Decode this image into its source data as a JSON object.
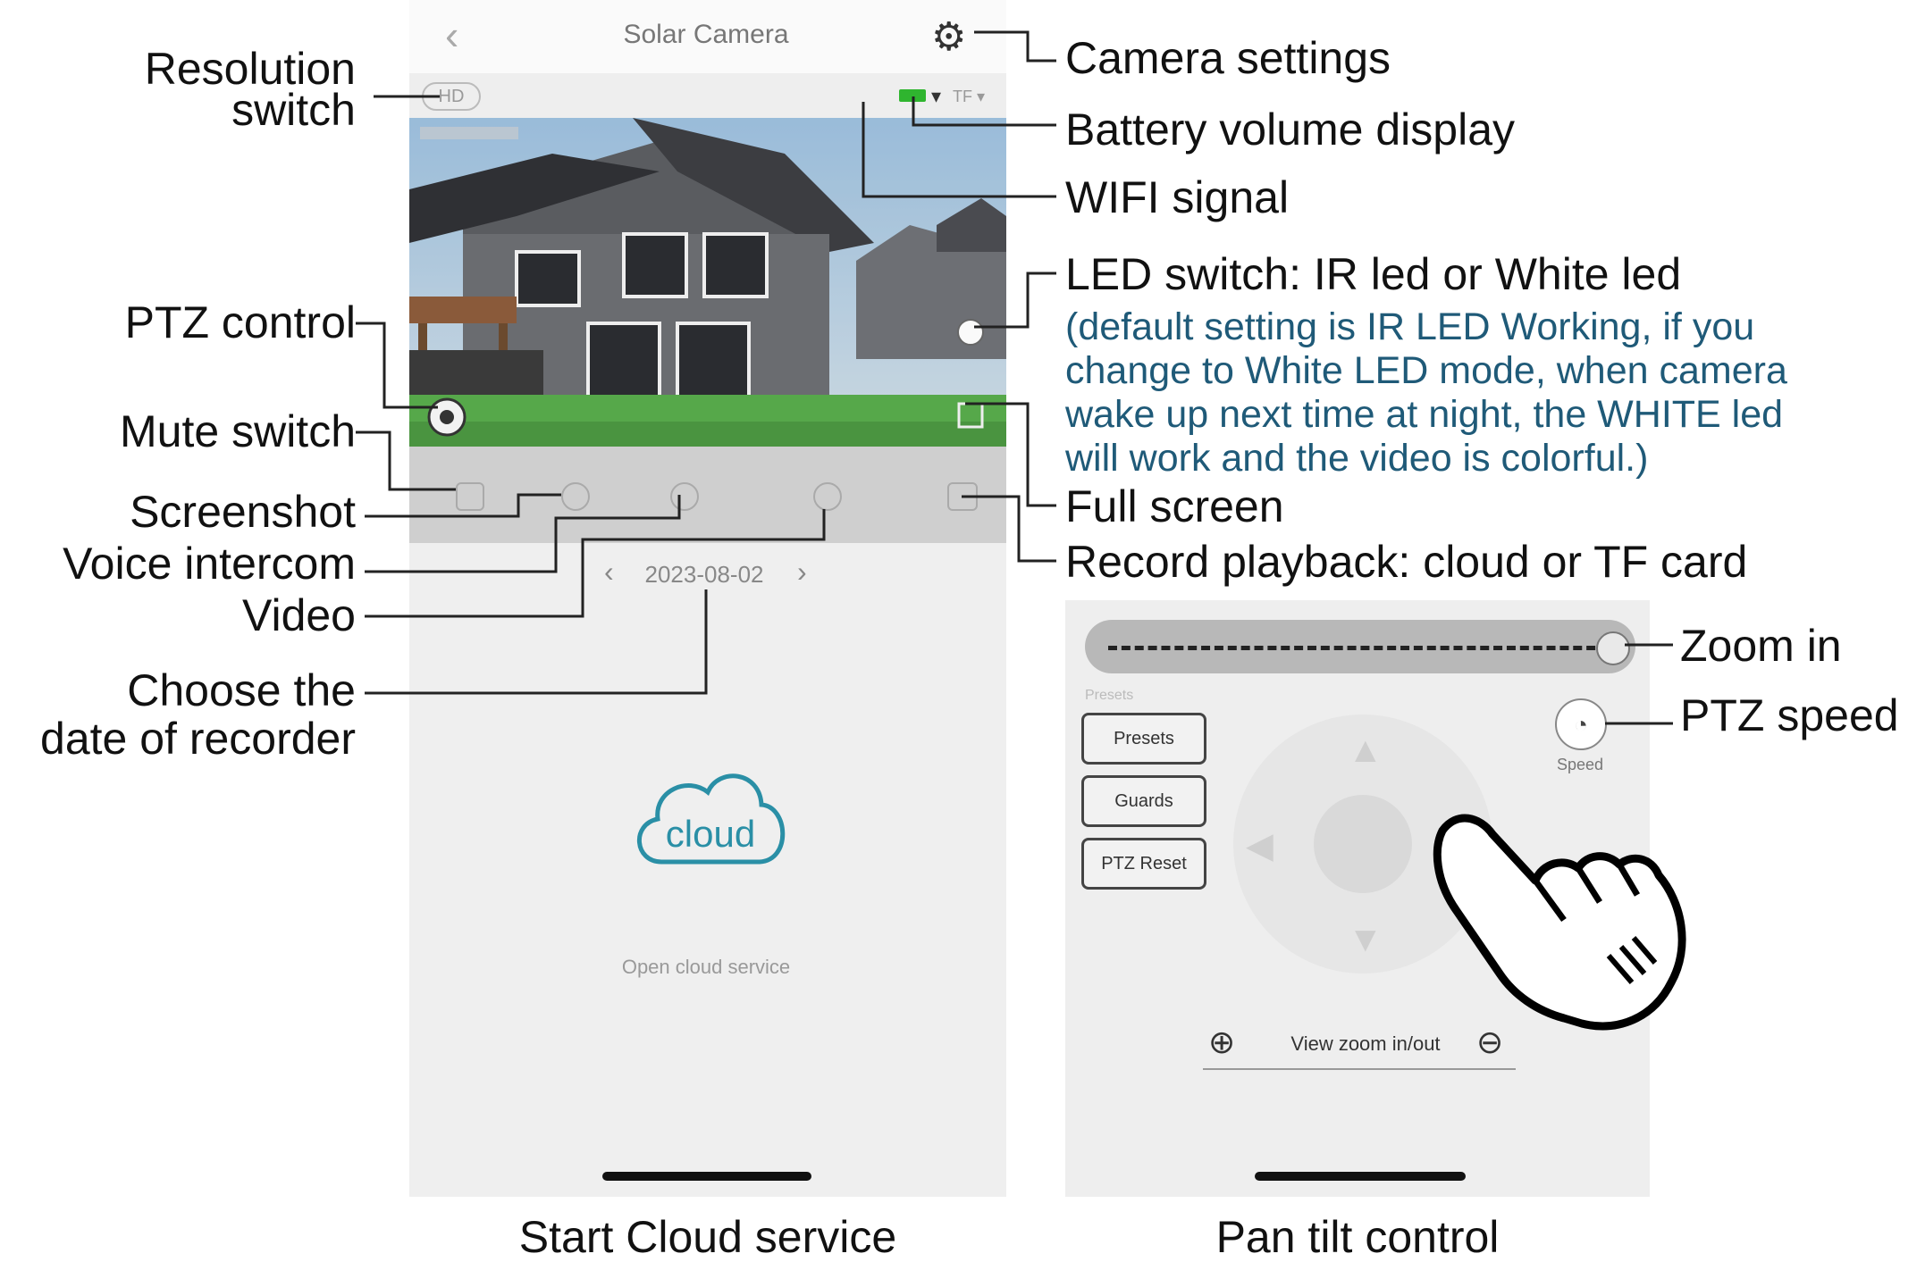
{
  "left_phone": {
    "title": "Solar Camera",
    "back_icon": "chevron-left-icon",
    "settings_icon": "gear-icon",
    "resolution_button": "HD",
    "signal_text": "TF ▾",
    "date": "2023-08-02",
    "date_prev_icon": "chevron-left-icon",
    "date_next_icon": "chevron-right-icon",
    "cloud_label": "cloud",
    "open_cloud_text": "Open cloud service"
  },
  "right_phone": {
    "presets_caption": "Presets",
    "buttons": [
      "Presets",
      "Guards",
      "PTZ Reset"
    ],
    "speed_label": "Speed",
    "zoom_label": "View zoom in/out",
    "zoom_in_icon": "zoom-in-icon",
    "zoom_out_icon": "zoom-out-icon"
  },
  "annotations_left": {
    "resolution_switch_1": "Resolution",
    "resolution_switch_2": "switch",
    "ptz_control": "PTZ control",
    "mute_switch": "Mute switch",
    "screenshot": "Screenshot",
    "voice_intercom": "Voice intercom",
    "video": "Video",
    "choose_date_1": "Choose the",
    "choose_date_2": "date of recorder"
  },
  "annotations_right": {
    "camera_settings": "Camera settings",
    "battery_volume": "Battery volume display",
    "wifi_signal": "WIFI signal",
    "led_switch": "LED switch: IR led or White led",
    "led_note_1": "(default setting is IR LED Working, if you",
    "led_note_2": "change to White LED mode, when camera",
    "led_note_3": "wake up next time at night, the WHITE led",
    "led_note_4": "will work and the video is colorful.)",
    "full_screen": "Full screen",
    "record_playback": "Record playback: cloud or TF card",
    "zoom_in": "Zoom in",
    "ptz_speed": "PTZ speed"
  },
  "captions": {
    "left": "Start Cloud service",
    "right": "Pan tilt control"
  },
  "colors": {
    "note_text": "#1f5a78",
    "cloud_accent": "#2a8fa6",
    "battery_green": "#2fb52f"
  }
}
